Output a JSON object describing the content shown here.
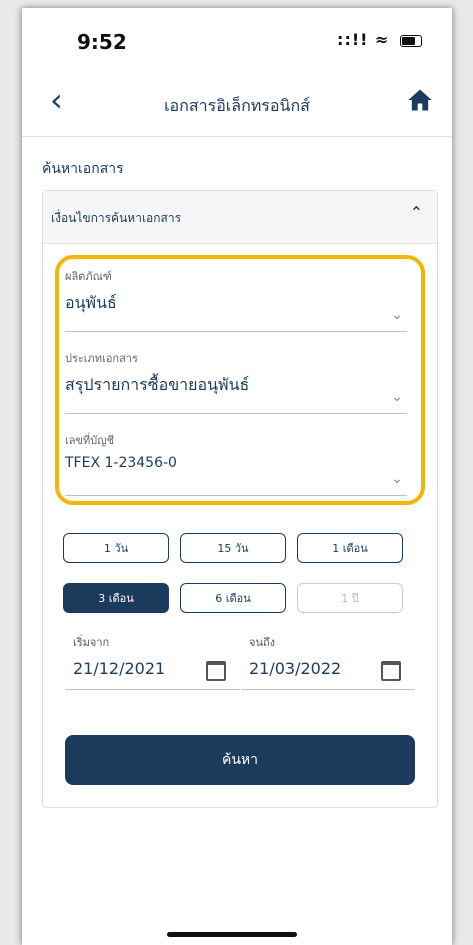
{
  "status": {
    "time": "9:52",
    "signal": "::!!",
    "wifi": "≈"
  },
  "header": {
    "title": "เอกสารอิเล็กทรอนิกส์",
    "back_icon": "chevron-left-icon",
    "home_icon": "home-icon"
  },
  "section_title": "ค้นหาเอกสาร",
  "conditions": {
    "label": "เงื่อนไขการค้นหาเอกสาร",
    "toggle_icon": "chevron-up-icon"
  },
  "fields": {
    "product": {
      "label": "ผลิตภัณฑ์",
      "value": "อนุพันธ์"
    },
    "doc_type": {
      "label": "ประเภทเอกสาร",
      "value": "สรุปรายการซื้อขายอนุพันธ์"
    },
    "account": {
      "label": "เลขที่บัญชี",
      "value": "TFEX 1-23456-0"
    }
  },
  "periods": [
    {
      "label": "1 วัน",
      "state": "normal"
    },
    {
      "label": "15 วัน",
      "state": "normal"
    },
    {
      "label": "1 เดือน",
      "state": "normal"
    },
    {
      "label": "3 เดือน",
      "state": "active"
    },
    {
      "label": "6 เดือน",
      "state": "normal"
    },
    {
      "label": "1 ปี",
      "state": "disabled"
    }
  ],
  "dates": {
    "start": {
      "label": "เริ่มจาก",
      "value": "21/12/2021"
    },
    "end": {
      "label": "จนถึง",
      "value": "21/03/2022"
    }
  },
  "search_button": "ค้นหา",
  "colors": {
    "primary": "#1b3a5c",
    "highlight": "#f2b705"
  }
}
